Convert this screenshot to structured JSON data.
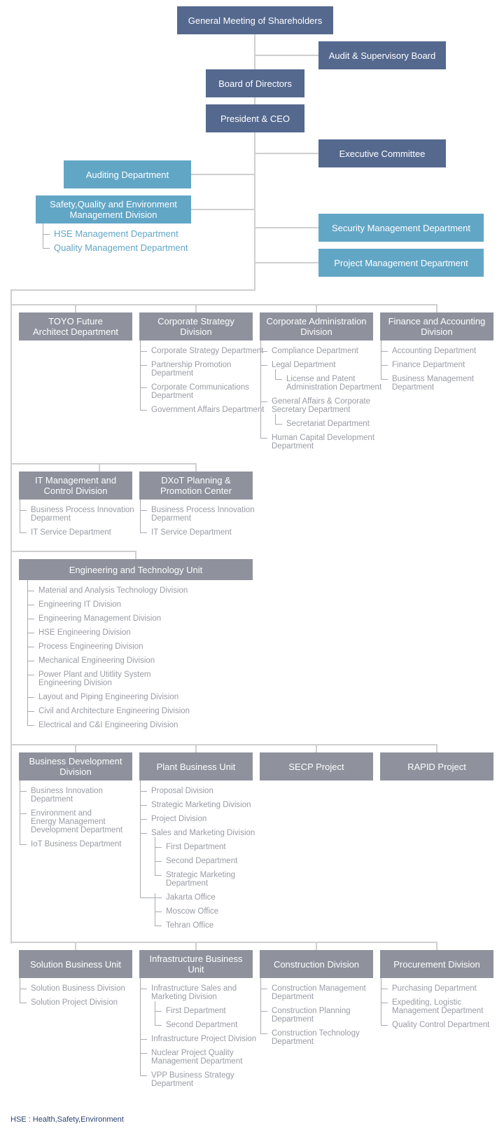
{
  "colors": {
    "executive": "#55698f",
    "staff": "#62a6c6",
    "division": "#8f929d",
    "connector": "#cfcfcf",
    "sub_text": "#9a9ca4"
  },
  "top": {
    "gms": "General Meeting of Shareholders",
    "audit_board": "Audit & Supervisory Board",
    "board": "Board of Directors",
    "president": "President & CEO",
    "executive_committee": "Executive Committee",
    "auditing": "Auditing Department",
    "sqe": "Safety,Quality and Environment\nManagement Division",
    "sqe_items": [
      {
        "label": "HSE Management Department"
      },
      {
        "label": "Quality Management Department"
      }
    ],
    "security": "Security Management Department",
    "project_mgmt": "Project Management Department"
  },
  "units": [
    {
      "title": "TOYO Future\nArchitect Department",
      "items": []
    },
    {
      "title": "Corporate Strategy\nDivision",
      "items": [
        {
          "label": "Corporate Strategy Department"
        },
        {
          "label": "Partnership Promotion\nDepartment"
        },
        {
          "label": "Corporate Communications\nDepartment"
        },
        {
          "label": "Government Affairs Department"
        }
      ]
    },
    {
      "title": "Corporate Administration\nDivision",
      "items": [
        {
          "label": "Compliance Department"
        },
        {
          "label": "Legal Department",
          "children": [
            {
              "label": "License and Patent\nAdministration Department"
            }
          ]
        },
        {
          "label": "General Affairs & Corporate\nSecretary Department",
          "children": [
            {
              "label": "Secretariat Department"
            }
          ]
        },
        {
          "label": "Human Capital Development\nDepartment"
        }
      ]
    },
    {
      "title": "Finance and Accounting\nDivision",
      "items": [
        {
          "label": "Accounting Department"
        },
        {
          "label": "Finance Department"
        },
        {
          "label": "Business Management\nDepartment"
        }
      ]
    },
    {
      "title": "IT Management and\nControl Division",
      "items": [
        {
          "label": "Business Process Innovation\nDeparment"
        },
        {
          "label": "IT Service Department"
        }
      ]
    },
    {
      "title": "DXoT Planning &\nPromotion Center",
      "items": [
        {
          "label": "Business Process Innovation\nDeparment"
        },
        {
          "label": "IT Service Department"
        }
      ]
    },
    {
      "title": "Engineering and Technology Unit",
      "items": [
        {
          "label": "Material and Analysis Technology Division"
        },
        {
          "label": "Engineering IT Division"
        },
        {
          "label": "Engineering Management Division"
        },
        {
          "label": "HSE Engineering Division"
        },
        {
          "label": "Process Engineering Division"
        },
        {
          "label": "Mechanical Engineering Division"
        },
        {
          "label": "Power Plant and Utitlity System\nEngineering Division"
        },
        {
          "label": "Layout and Piping Engineering Division"
        },
        {
          "label": "Civil and Architecture Engineering Division"
        },
        {
          "label": "Electrical and C&I Engineering Division"
        }
      ]
    },
    {
      "title": "Business Development\nDivision",
      "items": [
        {
          "label": "Business Innovation\nDepartment"
        },
        {
          "label": "Environment and\nEnergy Management\nDevelopment Department"
        },
        {
          "label": "IoT Business Department"
        }
      ]
    },
    {
      "title": "Plant Business Unit",
      "items": [
        {
          "label": "Proposal Division"
        },
        {
          "label": "Strategic Marketing Division"
        },
        {
          "label": "Project Division"
        },
        {
          "label": "Sales and Marketing Division",
          "children": [
            {
              "label": "First Department"
            },
            {
              "label": "Second Department"
            },
            {
              "label": "Strategic Marketing\nDepartment"
            }
          ]
        },
        {
          "children": [
            {
              "label": "Jakarta Office"
            },
            {
              "label": "Moscow Office"
            },
            {
              "label": "Tehran Office"
            }
          ]
        }
      ]
    },
    {
      "title": "SECP Project",
      "items": []
    },
    {
      "title": "RAPID Project",
      "items": []
    },
    {
      "title": "Solution Business Unit",
      "items": [
        {
          "label": "Solution Business Division"
        },
        {
          "label": "Solution Project Division"
        }
      ]
    },
    {
      "title": "Infrastructure Business\nUnit",
      "items": [
        {
          "label": "Infrastructure Sales and\nMarketing Division",
          "children": [
            {
              "label": "First Department"
            },
            {
              "label": "Second Department"
            }
          ]
        },
        {
          "label": "Infrastructure Project Division"
        },
        {
          "label": "Nuclear Project Quality\nManagement Department"
        },
        {
          "label": "VPP Business Strategy\nDepartment"
        }
      ]
    },
    {
      "title": "Construction Division",
      "items": [
        {
          "label": "Construction Management\nDepartment"
        },
        {
          "label": "Construction Planning\nDepartment"
        },
        {
          "label": "Construction Technology\nDepartment"
        }
      ]
    },
    {
      "title": "Procurement Division",
      "items": [
        {
          "label": "Purchasing Department"
        },
        {
          "label": "Expediting, Logistic\nManagement Department"
        },
        {
          "label": "Quality Control Department"
        }
      ]
    }
  ],
  "footer": "HSE : Health,Safety,Environment"
}
